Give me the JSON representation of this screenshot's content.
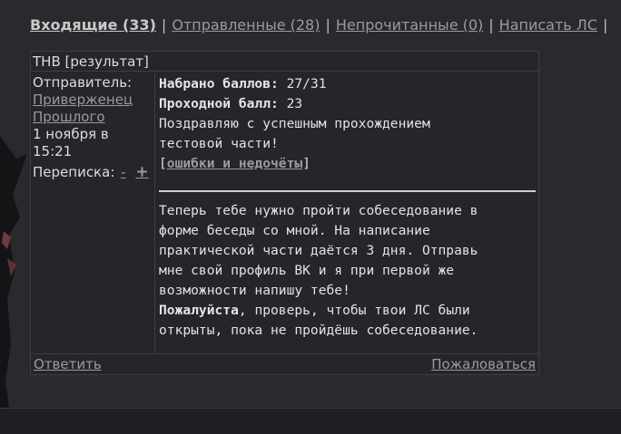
{
  "nav": {
    "inbox": "Входящие (33)",
    "sent": "Отправленные (28)",
    "unread": "Непрочитанные (0)",
    "compose": "Написать ЛС",
    "separator": "|"
  },
  "message": {
    "title": "ТНВ [результат]",
    "sender_label": "Отправитель:",
    "sender_name_line1": "Приверженец",
    "sender_name_line2": "Прошлого",
    "date_line1": "1 ноября в",
    "date_line2": "15:21",
    "thread_label": "Переписка:",
    "thread_minus": "-",
    "thread_plus": "+",
    "score_label": "Набрано баллов:",
    "score_value": "27/31",
    "pass_label": "Проходной балл:",
    "pass_value": "23",
    "congrats_line1": "Поздравляю с успешным прохождением",
    "congrats_line2": "тестовой части!",
    "errors_open": "[",
    "errors_link": "ошибки и недочёты",
    "errors_close": "]",
    "next_lines": [
      "Теперь тебе нужно пройти собеседование в",
      "форме беседы со мной. На написание",
      "практической части даётся 3 дня. Отправь",
      "мне свой профиль ВК и я при первой же",
      "возможности напишу тебе!"
    ],
    "please_bold": "Пожалуйста",
    "please_rest_line1": ", проверь, чтобы твои ЛС были",
    "please_line2": "открыты, пока не пройдёшь собеседование."
  },
  "footer": {
    "reply": "Ответить",
    "report": "Пожаловаться"
  }
}
